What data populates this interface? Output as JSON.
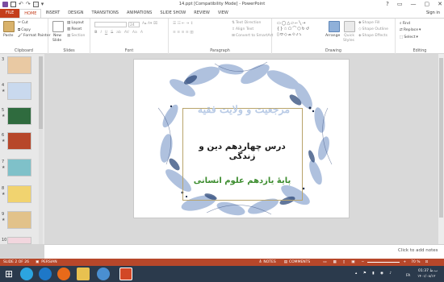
{
  "window": {
    "title": "14.ppt [Compatibility Mode] - PowerPoint",
    "controls": [
      "?",
      "▭",
      "—",
      "▢",
      "✕"
    ]
  },
  "ribbon_tabs": [
    "FILE",
    "HOME",
    "INSERT",
    "DESIGN",
    "TRANSITIONS",
    "ANIMATIONS",
    "SLIDE SHOW",
    "REVIEW",
    "VIEW"
  ],
  "active_tab": "HOME",
  "signin": "Sign in",
  "ribbon": {
    "clipboard": {
      "label": "Clipboard",
      "paste": "Paste",
      "cut": "Cut",
      "copy": "Copy",
      "format_painter": "Format Painter"
    },
    "slides": {
      "label": "Slides",
      "new_slide": "New",
      "new_slide2": "Slide",
      "layout": "Layout",
      "reset": "Reset",
      "section": "Section"
    },
    "font": {
      "label": "Font",
      "size": "24"
    },
    "paragraph": {
      "label": "Paragraph",
      "text_direction": "Text Direction",
      "align_text": "Align Text",
      "convert_smartart": "Convert to SmartArt"
    },
    "drawing": {
      "label": "Drawing",
      "arrange": "Arrange",
      "quick_styles": "Quick",
      "quick_styles2": "Styles",
      "shape_fill": "Shape Fill",
      "shape_outline": "Shape Outline",
      "shape_effects": "Shape Effects"
    },
    "editing": {
      "label": "Editing",
      "find": "Find",
      "replace": "Replace",
      "select": "Select"
    }
  },
  "thumbnails": [
    {
      "num": "3",
      "star": "",
      "color": "#e9c9a3"
    },
    {
      "num": "4",
      "star": "★",
      "color": "#c9d9ee"
    },
    {
      "num": "5",
      "star": "★",
      "color": "#2f6b3e"
    },
    {
      "num": "6",
      "star": "★",
      "color": "#b7472a"
    },
    {
      "num": "7",
      "star": "★",
      "color": "#7fc1c9"
    },
    {
      "num": "8",
      "star": "★",
      "color": "#f1d36f"
    },
    {
      "num": "9",
      "star": "★",
      "color": "#e2c28a"
    },
    {
      "num": "10",
      "star": "",
      "color": "#f2d6de"
    }
  ],
  "slide": {
    "title": "مرجعیت و ولایت فقیه",
    "subtitle": "درس چهاردهم دین و زندگی",
    "grade": "پایۀ یازدهم علوم انسانی"
  },
  "notes_placeholder": "Click to add notes",
  "status": {
    "slide_count": "SLIDE 2 OF 26",
    "language": "PERSIAN",
    "notes": "NOTES",
    "comments": "COMMENTS",
    "zoom": "70 %"
  },
  "taskbar": {
    "time": "01:37 ب.ظ",
    "date": "۱۴۰۱/۰۸/۱۲",
    "lang": "FA"
  },
  "colors": {
    "accent": "#c43e1c",
    "status_bar": "#b7472a",
    "taskbar": "#2b3a4c"
  }
}
